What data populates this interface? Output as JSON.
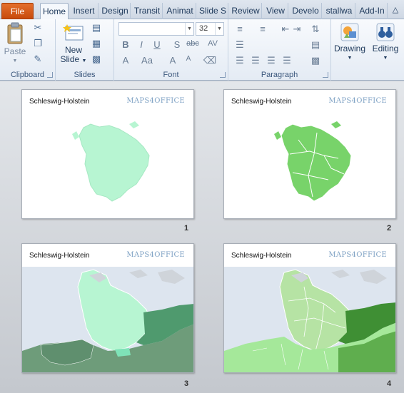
{
  "tabs": [
    {
      "label": "File",
      "kind": "file"
    },
    {
      "label": "Home",
      "kind": "active"
    },
    {
      "label": "Insert"
    },
    {
      "label": "Design"
    },
    {
      "label": "Transit"
    },
    {
      "label": "Animat"
    },
    {
      "label": "Slide S"
    },
    {
      "label": "Review"
    },
    {
      "label": "View"
    },
    {
      "label": "Develo"
    },
    {
      "label": "stallwa"
    },
    {
      "label": "Add-In"
    }
  ],
  "ribbon": {
    "clipboard": {
      "paste_label": "Paste",
      "group_label": "Clipboard"
    },
    "slides": {
      "new_slide_line1": "New",
      "new_slide_line2": "Slide",
      "group_label": "Slides"
    },
    "font": {
      "font_name": "",
      "font_size": "32",
      "group_label": "Font"
    },
    "paragraph": {
      "group_label": "Paragraph"
    },
    "drawing": {
      "label": "Drawing"
    },
    "editing": {
      "label": "Editing"
    }
  },
  "slides": [
    {
      "title": "Schleswig-Holstein",
      "logo": "MAPS4OFFICE",
      "number": "1"
    },
    {
      "title": "Schleswig-Holstein",
      "logo": "MAPS4OFFICE",
      "number": "2"
    },
    {
      "title": "Schleswig-Holstein",
      "logo": "MAPS4OFFICE",
      "number": "3"
    },
    {
      "title": "Schleswig-Holstein",
      "logo": "MAPS4OFFICE",
      "number": "4"
    }
  ],
  "colors": {
    "file_tab": "#d05a18",
    "map_light": "#b7f5d2",
    "map_green": "#78d36a",
    "map_dark": "#4f9a6e",
    "sea": "#dde5ef"
  }
}
